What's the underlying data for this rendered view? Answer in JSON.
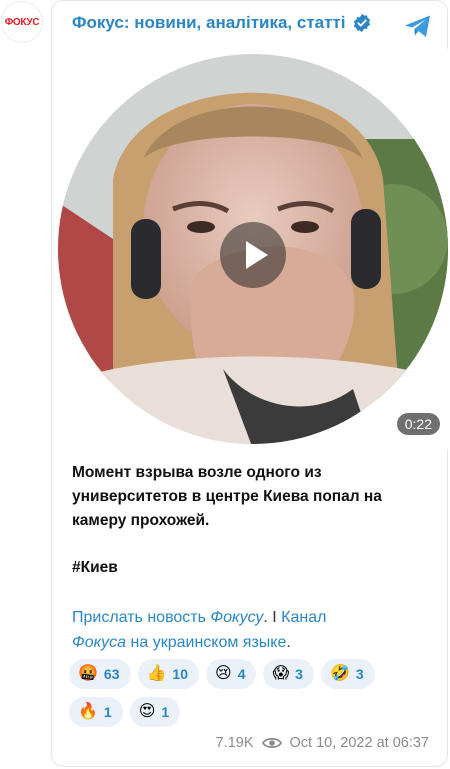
{
  "avatar": {
    "text": "ФОКУС"
  },
  "header": {
    "title": "Фокус: новини, аналітика, статті"
  },
  "video": {
    "duration": "0:22"
  },
  "post": {
    "line1": "Момент взрыва возле одного из",
    "line2": "университетов в центре Киева попал на",
    "line3": "камеру прохожей.",
    "hashtag": "#Киев"
  },
  "links": {
    "send_prefix": "Прислать новость ",
    "send_italic": "Фокусу",
    "separator": ". I ",
    "channel_prefix": "Канал",
    "channel_italic": "Фокуса",
    "channel_suffix": " на украинском языке",
    "end": "."
  },
  "reactions": [
    {
      "emoji": "🤬",
      "count": "63"
    },
    {
      "emoji": "👍",
      "count": "10"
    },
    {
      "emoji": "😢",
      "count": "4"
    },
    {
      "emoji": "😱",
      "count": "3"
    },
    {
      "emoji": "🤣",
      "count": "3"
    },
    {
      "emoji": "🔥",
      "count": "1"
    },
    {
      "emoji": "😍",
      "count": "1"
    }
  ],
  "footer": {
    "views": "7.19K",
    "date": "Oct 10, 2022 at 06:37"
  },
  "colors": {
    "accent": "#2a86c4",
    "brand": "#e21b23",
    "reaction_bg": "#eaf1f8"
  }
}
